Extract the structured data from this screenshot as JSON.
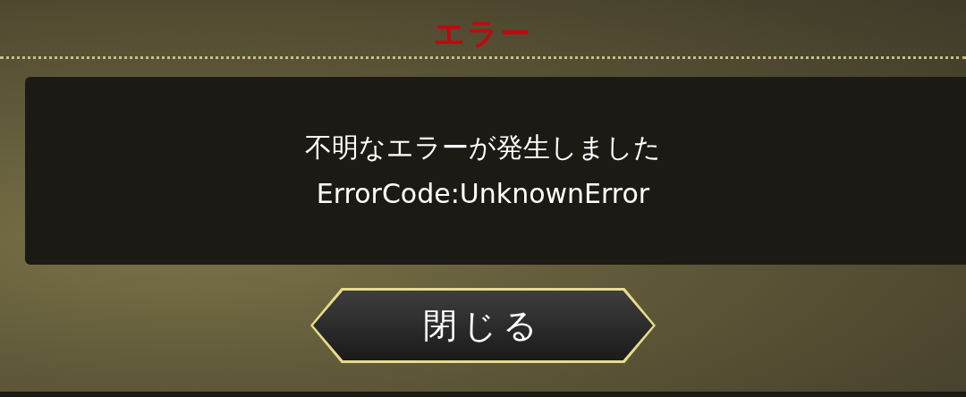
{
  "dialog": {
    "title": "エラー",
    "message": [
      "不明なエラーが発生しました",
      "ErrorCode:UnknownError"
    ],
    "buttons": [
      "閉じる"
    ]
  }
}
